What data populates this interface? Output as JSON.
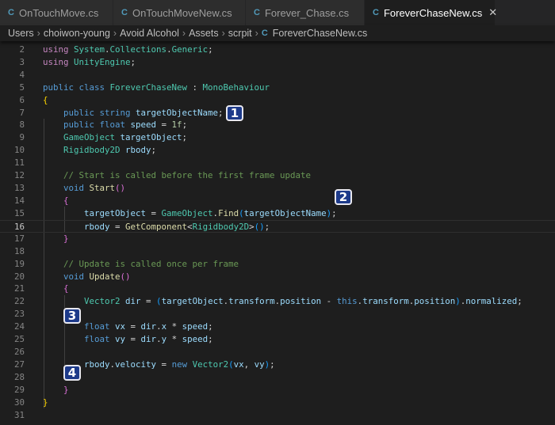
{
  "tabs": [
    {
      "label": "OnTouchMove.cs",
      "icon": "csharp-icon",
      "active": false
    },
    {
      "label": "OnTouchMoveNew.cs",
      "icon": "csharp-icon",
      "active": false
    },
    {
      "label": "Forever_Chase.cs",
      "icon": "csharp-icon",
      "active": false
    },
    {
      "label": "ForeverChaseNew.cs",
      "icon": "csharp-icon",
      "active": true
    }
  ],
  "breadcrumb": [
    "Users",
    "choiwon-young",
    "Avoid Alcohol",
    "Assets",
    "scrpit",
    "ForeverChaseNew.cs"
  ],
  "current_line": 16,
  "palette": {
    "kw": "#569cd6",
    "ctl": "#c586c0",
    "type": "#4ec9b0",
    "var": "#9cdcfe",
    "fn": "#dcdcaa",
    "cm": "#6a9955",
    "num": "#b5cea8",
    "b1": "#ffd700",
    "b2": "#da70d6",
    "b3": "#179fff",
    "p": "#d4d4d4"
  },
  "code": [
    [
      [
        "using ",
        "ctl"
      ],
      [
        "System",
        "type"
      ],
      [
        ".",
        "p"
      ],
      [
        "Collections",
        "type"
      ],
      [
        ";",
        "p"
      ]
    ],
    [
      [
        "using ",
        "ctl"
      ],
      [
        "System",
        "type"
      ],
      [
        ".",
        "p"
      ],
      [
        "Collections",
        "type"
      ],
      [
        ".",
        "p"
      ],
      [
        "Generic",
        "type"
      ],
      [
        ";",
        "p"
      ]
    ],
    [
      [
        "using ",
        "ctl"
      ],
      [
        "UnityEngine",
        "type"
      ],
      [
        ";",
        "p"
      ]
    ],
    [],
    [
      [
        "public class ",
        "kw"
      ],
      [
        "ForeverChaseNew",
        "type"
      ],
      [
        " : ",
        "p"
      ],
      [
        "MonoBehaviour",
        "type"
      ]
    ],
    [
      [
        "{",
        "b1"
      ]
    ],
    [
      [
        "    public string ",
        "kw"
      ],
      [
        "targetObjectName",
        "var"
      ],
      [
        ";",
        "p"
      ]
    ],
    [
      [
        "    public float ",
        "kw"
      ],
      [
        "speed",
        "var"
      ],
      [
        " = ",
        "p"
      ],
      [
        "1f",
        "num"
      ],
      [
        ";",
        "p"
      ]
    ],
    [
      [
        "    GameObject ",
        "type"
      ],
      [
        "targetObject",
        "var"
      ],
      [
        ";",
        "p"
      ]
    ],
    [
      [
        "    Rigidbody2D ",
        "type"
      ],
      [
        "rbody",
        "var"
      ],
      [
        ";",
        "p"
      ]
    ],
    [],
    [
      [
        "    // Start is called before the first frame update",
        "cm"
      ]
    ],
    [
      [
        "    void ",
        "kw"
      ],
      [
        "Start",
        "fn"
      ],
      [
        "()",
        "b2"
      ]
    ],
    [
      [
        "    {",
        "b2"
      ]
    ],
    [
      [
        "        targetObject",
        "var"
      ],
      [
        " = ",
        "p"
      ],
      [
        "GameObject",
        "type"
      ],
      [
        ".",
        "p"
      ],
      [
        "Find",
        "fn"
      ],
      [
        "(",
        "b3"
      ],
      [
        "targetObjectName",
        "var"
      ],
      [
        ")",
        "b3"
      ],
      [
        ";",
        "p"
      ]
    ],
    [
      [
        "        rbody",
        "var"
      ],
      [
        " = ",
        "p"
      ],
      [
        "GetComponent",
        "fn"
      ],
      [
        "<",
        "p"
      ],
      [
        "Rigidbody2D",
        "type"
      ],
      [
        ">",
        "p"
      ],
      [
        "()",
        "b3"
      ],
      [
        ";",
        "p"
      ]
    ],
    [
      [
        "    }",
        "b2"
      ]
    ],
    [],
    [
      [
        "    // Update is called once per frame",
        "cm"
      ]
    ],
    [
      [
        "    void ",
        "kw"
      ],
      [
        "Update",
        "fn"
      ],
      [
        "()",
        "b2"
      ]
    ],
    [
      [
        "    {",
        "b2"
      ]
    ],
    [
      [
        "        Vector2 ",
        "type"
      ],
      [
        "dir",
        "var"
      ],
      [
        " = ",
        "p"
      ],
      [
        "(",
        "b3"
      ],
      [
        "targetObject",
        "var"
      ],
      [
        ".",
        "p"
      ],
      [
        "transform",
        "var"
      ],
      [
        ".",
        "p"
      ],
      [
        "position",
        "var"
      ],
      [
        " - ",
        "p"
      ],
      [
        "this",
        "kw"
      ],
      [
        ".",
        "p"
      ],
      [
        "transform",
        "var"
      ],
      [
        ".",
        "p"
      ],
      [
        "position",
        "var"
      ],
      [
        ")",
        "b3"
      ],
      [
        ".",
        "p"
      ],
      [
        "normalized",
        "var"
      ],
      [
        ";",
        "p"
      ]
    ],
    [],
    [
      [
        "        float ",
        "kw"
      ],
      [
        "vx",
        "var"
      ],
      [
        " = ",
        "p"
      ],
      [
        "dir",
        "var"
      ],
      [
        ".",
        "p"
      ],
      [
        "x",
        "var"
      ],
      [
        " * ",
        "p"
      ],
      [
        "speed",
        "var"
      ],
      [
        ";",
        "p"
      ]
    ],
    [
      [
        "        float ",
        "kw"
      ],
      [
        "vy",
        "var"
      ],
      [
        " = ",
        "p"
      ],
      [
        "dir",
        "var"
      ],
      [
        ".",
        "p"
      ],
      [
        "y",
        "var"
      ],
      [
        " * ",
        "p"
      ],
      [
        "speed",
        "var"
      ],
      [
        ";",
        "p"
      ]
    ],
    [],
    [
      [
        "        rbody",
        "var"
      ],
      [
        ".",
        "p"
      ],
      [
        "velocity",
        "var"
      ],
      [
        " = ",
        "p"
      ],
      [
        "new ",
        "kw"
      ],
      [
        "Vector2",
        "type"
      ],
      [
        "(",
        "b3"
      ],
      [
        "vx",
        "var"
      ],
      [
        ", ",
        "p"
      ],
      [
        "vy",
        "var"
      ],
      [
        ")",
        "b3"
      ],
      [
        ";",
        "p"
      ]
    ],
    [],
    [
      [
        "    }",
        "b2"
      ]
    ],
    [
      [
        "}",
        "b1"
      ]
    ],
    []
  ],
  "badges": [
    "1",
    "2",
    "3",
    "4"
  ]
}
